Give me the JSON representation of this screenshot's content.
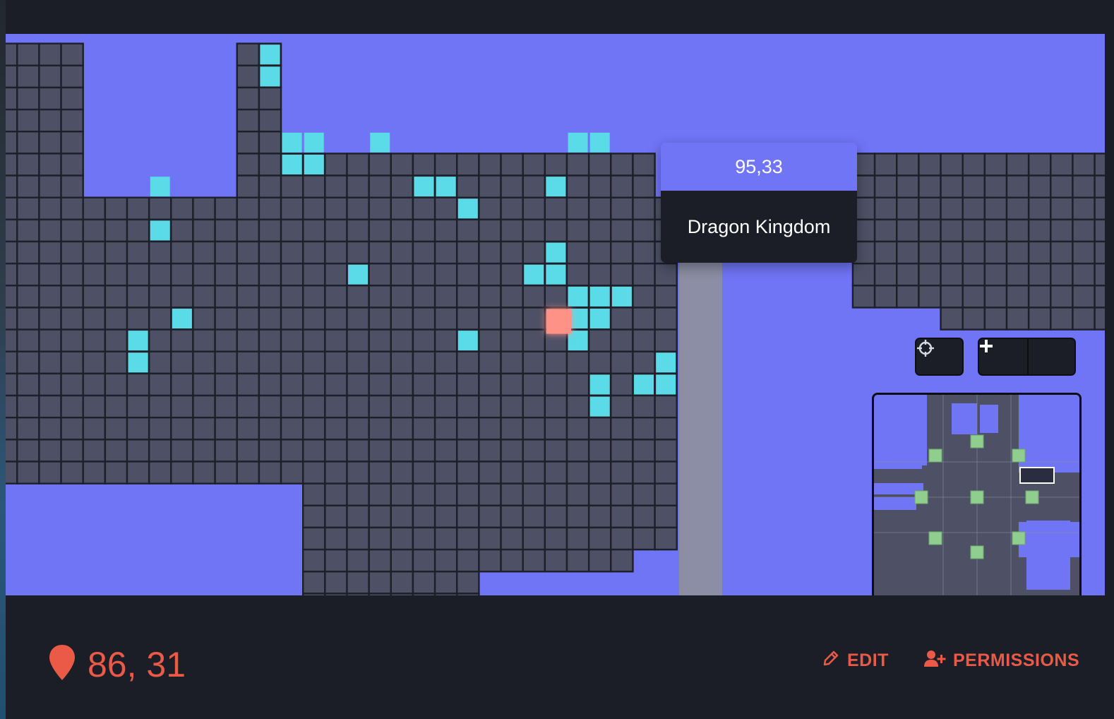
{
  "tooltip": {
    "coords": "95,33",
    "name": "Dragon Kingdom"
  },
  "controls": {
    "recenter_icon": "crosshair-icon",
    "zoom_in_icon": "plus-icon",
    "zoom_out_icon": "minus-icon"
  },
  "footer": {
    "pin_icon": "map-pin-icon",
    "coordinates": "86, 31",
    "edit_label": "EDIT",
    "edit_icon": "pencil-icon",
    "permissions_label": "PERMISSIONS",
    "permissions_icon": "user-plus-icon"
  },
  "colors": {
    "parcel": "#4e5066",
    "grid_line": "#1d1f29",
    "water": "#7075f6",
    "road": "#8b8ea4",
    "owned_parcel": "#5bdae8",
    "selected_parcel": "#ff9286",
    "accent": "#ea5a47",
    "plaza": "#8fce8f"
  }
}
